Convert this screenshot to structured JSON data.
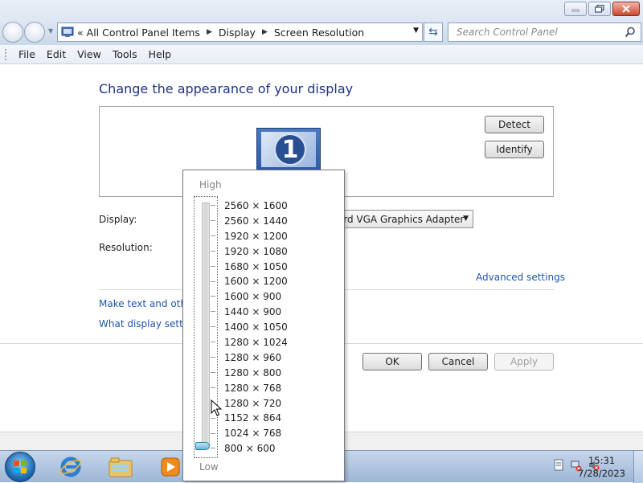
{
  "window": {
    "minimize_icon": "minimize-icon",
    "maximize_icon": "restore-icon",
    "close_icon": "close-icon"
  },
  "address": {
    "overflow": "«",
    "crumbs": [
      "All Control Panel Items",
      "Display",
      "Screen Resolution"
    ],
    "search_placeholder": "Search Control Panel"
  },
  "menu": [
    "File",
    "Edit",
    "View",
    "Tools",
    "Help"
  ],
  "content": {
    "heading": "Change the appearance of your display",
    "monitor_number": "1",
    "detect_label": "Detect",
    "identify_label": "Identify",
    "display_label": "Display:",
    "display_value": "Standard VGA Graphics Adapter",
    "resolution_label": "Resolution:",
    "advanced_link": "Advanced settings",
    "text_link": "Make text and other",
    "what_link": "What display setting",
    "ok_label": "OK",
    "cancel_label": "Cancel",
    "apply_label": "Apply"
  },
  "resolution_popup": {
    "high_label": "High",
    "low_label": "Low",
    "selected": "800 × 600",
    "options": [
      "2560 × 1600",
      "2560 × 1440",
      "1920 × 1200",
      "1920 × 1080",
      "1680 × 1050",
      "1600 × 1200",
      "1600 × 900",
      "1440 × 900",
      "1400 × 1050",
      "1280 × 1024",
      "1280 × 960",
      "1280 × 800",
      "1280 × 768",
      "1280 × 720",
      "1152 × 864",
      "1024 × 768",
      "800 × 600"
    ]
  },
  "taskbar": {
    "apps": [
      "internet-explorer-icon",
      "windows-explorer-icon",
      "media-player-icon"
    ],
    "time": "15:31",
    "date": "7/28/2023"
  },
  "colors": {
    "heading": "#1e3287",
    "link": "#1f55aa",
    "taskbar": "#9db6d6"
  }
}
